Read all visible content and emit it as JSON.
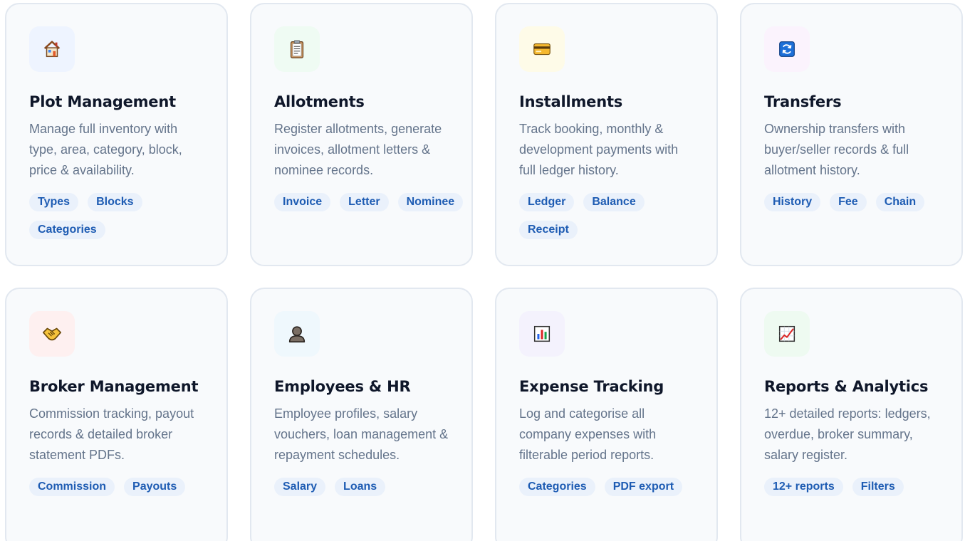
{
  "cards": [
    {
      "icon": "house-icon",
      "icon_bg": "#eef4ff",
      "title": "Plot Management",
      "description": "Manage full inventory with type, area, category, block, price & availability.",
      "tags": [
        "Types",
        "Blocks",
        "Categories"
      ]
    },
    {
      "icon": "clipboard-icon",
      "icon_bg": "#effbf3",
      "title": "Allotments",
      "description": "Register allotments, generate invoices, allotment letters & nominee records.",
      "tags": [
        "Invoice",
        "Letter",
        "Nominee"
      ]
    },
    {
      "icon": "credit-card-icon",
      "icon_bg": "#fefbe8",
      "title": "Installments",
      "description": "Track booking, monthly & development payments with full ledger history.",
      "tags": [
        "Ledger",
        "Balance",
        "Receipt"
      ]
    },
    {
      "icon": "refresh-icon",
      "icon_bg": "#fbf3fd",
      "title": "Transfers",
      "description": "Ownership transfers with buyer/seller records & full allotment history.",
      "tags": [
        "History",
        "Fee",
        "Chain"
      ]
    },
    {
      "icon": "handshake-icon",
      "icon_bg": "#fef0f0",
      "title": "Broker Management",
      "description": "Commission tracking, payout records & detailed broker statement PDFs.",
      "tags": [
        "Commission",
        "Payouts"
      ]
    },
    {
      "icon": "person-icon",
      "icon_bg": "#eff8fd",
      "title": "Employees & HR",
      "description": "Employee profiles, salary vouchers, loan management & repayment schedules.",
      "tags": [
        "Salary",
        "Loans"
      ]
    },
    {
      "icon": "bar-chart-icon",
      "icon_bg": "#f4f2fd",
      "title": "Expense Tracking",
      "description": "Log and categorise all company expenses with filterable period reports.",
      "tags": [
        "Categories",
        "PDF export"
      ]
    },
    {
      "icon": "trend-chart-icon",
      "icon_bg": "#eefaf1",
      "title": "Reports & Analytics",
      "description": "12+ detailed reports: ledgers, overdue, broker summary, salary register.",
      "tags": [
        "12+ reports",
        "Filters"
      ]
    }
  ]
}
